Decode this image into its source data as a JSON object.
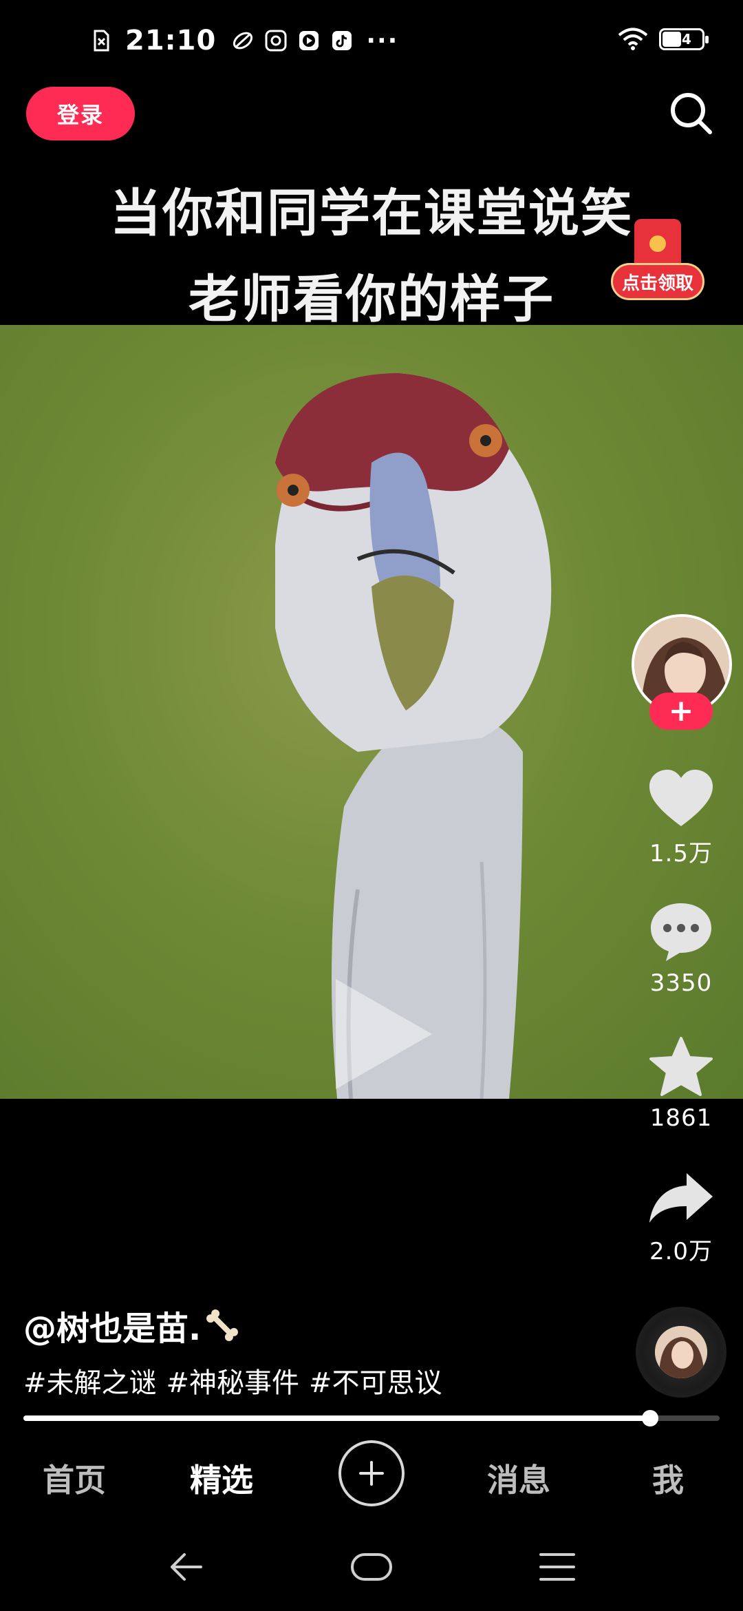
{
  "status_bar": {
    "time": "21:10",
    "more": "···",
    "battery_level": "44",
    "icons": [
      "sim-off-icon",
      "app-leaf-icon",
      "app-baidu-icon",
      "play-app-icon",
      "douyin-icon",
      "wifi-icon",
      "battery-icon"
    ]
  },
  "header": {
    "login_label": "登录",
    "search_icon": "search-icon"
  },
  "video": {
    "caption_line1": "当你和同学在课堂说笑",
    "caption_line2": "老师看你的样子",
    "red_packet_label": "点击领取",
    "progress": 0.9
  },
  "actions": {
    "follow_label": "+",
    "likes": "1.5万",
    "comments": "3350",
    "favorites": "1861",
    "shares": "2.0万"
  },
  "post": {
    "author": "@树也是苗.",
    "tags": [
      "#未解之谜",
      "#神秘事件",
      "#不可思议"
    ]
  },
  "bottom_nav": {
    "home": "首页",
    "featured": "精选",
    "add": "+",
    "messages": "消息",
    "me": "我"
  },
  "colors": {
    "accent": "#fe2c55",
    "background": "#000000",
    "video_bg": "#6f8a36"
  }
}
